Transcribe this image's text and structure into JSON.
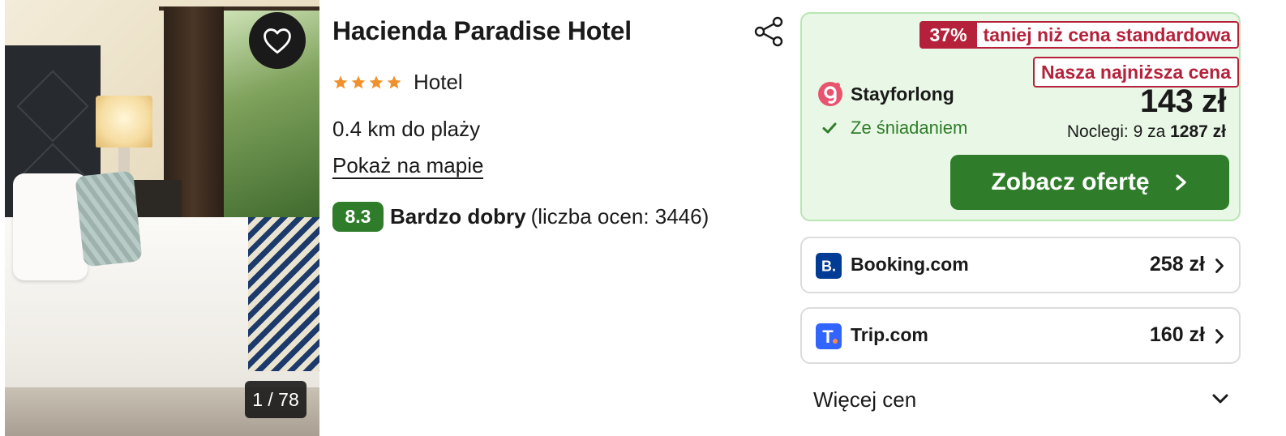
{
  "gallery": {
    "counter": "1 / 78"
  },
  "hotel": {
    "name": "Hacienda Paradise Hotel",
    "stars": 4,
    "type": "Hotel",
    "distance": "0.4 km do plaży",
    "map_link": "Pokaż na mapie",
    "rating_score": "8.3",
    "rating_word": "Bardzo dobry",
    "rating_count": "(liczba ocen: 3446)"
  },
  "main_offer": {
    "discount_pct": "37%",
    "discount_text": "taniej niż cena standardowa",
    "lowest_label": "Nasza najniższa cena",
    "provider": "Stayforlong",
    "breakfast": "Ze śniadaniem",
    "price": "143 zł",
    "nights_prefix": "Noclegi: 9 za",
    "nights_total": "1287 zł",
    "cta": "Zobacz ofertę"
  },
  "other_offers": [
    {
      "provider": "Booking.com",
      "price": "258 zł",
      "logo_text": "B."
    },
    {
      "provider": "Trip.com",
      "price": "160 zł",
      "logo_text": "T."
    }
  ],
  "more_prices": "Więcej cen",
  "colors": {
    "green": "#2f7d2a",
    "green_bg": "#e9f8e6",
    "red": "#b5213a",
    "star": "#f0922b",
    "booking_blue": "#003b95",
    "trip_blue": "#3264ff"
  },
  "icons": {
    "favorite": "heart-outline-icon",
    "share": "share-icon",
    "star": "star-icon",
    "check": "check-icon",
    "chevron_right": "chevron-right-icon",
    "chevron_down": "chevron-down-icon"
  }
}
